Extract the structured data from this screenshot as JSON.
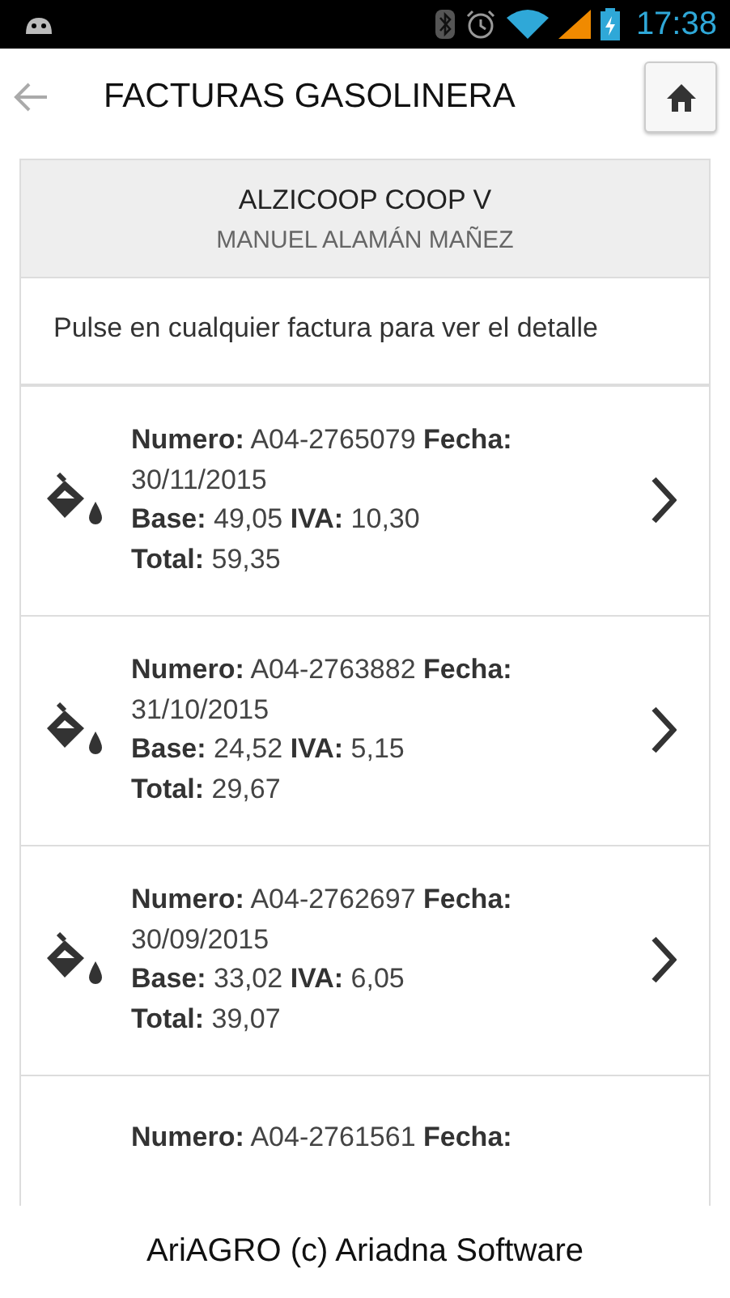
{
  "status_bar": {
    "time": "17:38"
  },
  "header": {
    "title": "FACTURAS GASOLINERA"
  },
  "card": {
    "title": "ALZICOOP COOP V",
    "subtitle": "MANUEL ALAMÁN MAÑEZ",
    "instruction": "Pulse en cualquier factura para ver el detalle"
  },
  "invoices": [
    {
      "kind": "full",
      "lines": [
        "**Numero:** A04-2765079 **Fecha:** 30/11/2015",
        "**Base:** 49,05 **IVA:** 10,30",
        "**Total:** 59,35"
      ]
    },
    {
      "kind": "full",
      "lines": [
        "**Numero:** A04-2763882 **Fecha:** 31/10/2015",
        "**Base:** 24,52 **IVA:** 5,15",
        "**Total:** 29,67"
      ]
    },
    {
      "kind": "full",
      "lines": [
        "**Numero:** A04-2762697 **Fecha:** 30/09/2015",
        "**Base:** 33,02 **IVA:** 6,05",
        "**Total:** 39,07"
      ]
    },
    {
      "kind": "partial",
      "lines": [
        "**Numero:** A04-2761561 **Fecha:**"
      ]
    }
  ],
  "footer": {
    "text": "AriAGRO (c) Ariadna Software"
  }
}
